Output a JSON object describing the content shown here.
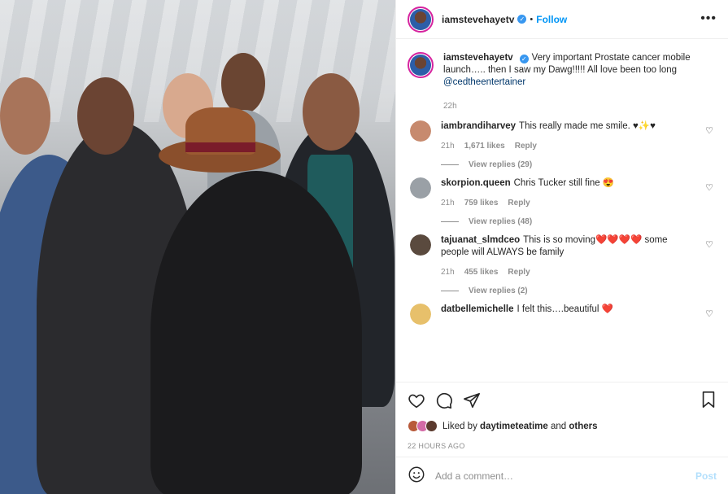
{
  "header": {
    "username": "iamstevehayetv",
    "follow_label": "Follow",
    "separator": "•",
    "more_label": "•••"
  },
  "caption": {
    "username": "iamstevehayetv",
    "text": "Very important Prostate cancer mobile launch….. then I saw my Dawg!!!!! All love been too long",
    "mention": "@cedtheentertainer",
    "time": "22h"
  },
  "comments": [
    {
      "username": "iambrandiharvey",
      "text": "This really made me smile. ♥✨♥",
      "time": "21h",
      "likes": "1,671 likes",
      "reply_label": "Reply",
      "view_replies": "View replies (29)",
      "avatar_color": "#c78a6e"
    },
    {
      "username": "skorpion.queen",
      "text": "Chris Tucker still fine 😍",
      "time": "21h",
      "likes": "759 likes",
      "reply_label": "Reply",
      "view_replies": "View replies (48)",
      "avatar_color": "#9aa0a6"
    },
    {
      "username": "tajuanat_slmdceo",
      "text": "This is so moving❤️❤️❤️❤️ some people will ALWAYS be family",
      "time": "21h",
      "likes": "455 likes",
      "reply_label": "Reply",
      "view_replies": "View replies (2)",
      "avatar_color": "#5a4a3e"
    },
    {
      "username": "datbellemichelle",
      "text": "I felt this….beautiful ❤️",
      "avatar_color": "#e7c06b"
    }
  ],
  "likes_row": {
    "prefix": "Liked by",
    "user": "daytimeteatime",
    "and": "and",
    "others": "others"
  },
  "timestamp": "22 HOURS AGO",
  "add_comment": {
    "placeholder": "Add a comment…",
    "post_label": "Post"
  },
  "colors": {
    "accent": "#0095f6",
    "verified": "#3897f0",
    "muted": "#8e8e8e"
  },
  "icons": [
    "heart-icon",
    "comment-icon",
    "share-icon",
    "bookmark-icon",
    "emoji-icon",
    "verified-badge-icon"
  ]
}
